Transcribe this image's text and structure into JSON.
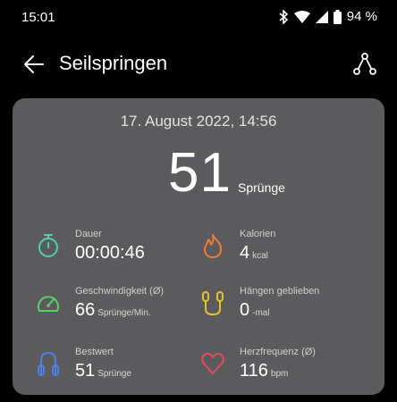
{
  "status_bar": {
    "time": "15:01",
    "battery": "94 %"
  },
  "app_bar": {
    "title": "Seilspringen"
  },
  "summary": {
    "date": "17. August 2022, 14:56",
    "jumps_value": "51",
    "jumps_unit": "Sprünge"
  },
  "stats": [
    {
      "label": "Dauer",
      "value": "00:00:46",
      "unit": "",
      "icon": "stopwatch-icon",
      "color": "#4fd1a8"
    },
    {
      "label": "Kalorien",
      "value": "4",
      "unit": "kcal",
      "icon": "flame-icon",
      "color": "#ef7a3a"
    },
    {
      "label": "Geschwindigkeit (Ø)",
      "value": "66",
      "unit": "Sprünge/Min.",
      "icon": "speedometer-icon",
      "color": "#5bcf6a"
    },
    {
      "label": "Hängen geblieben",
      "value": "0",
      "unit": "-mal",
      "icon": "jump-rope-icon",
      "color": "#e6c22f"
    },
    {
      "label": "Bestwert",
      "value": "51",
      "unit": "Sprünge",
      "icon": "jump-rope-icon",
      "color": "#4d7fe6"
    },
    {
      "label": "Herzfrequenz (Ø)",
      "value": "116",
      "unit": "bpm",
      "icon": "heart-icon",
      "color": "#e44b5c"
    }
  ]
}
